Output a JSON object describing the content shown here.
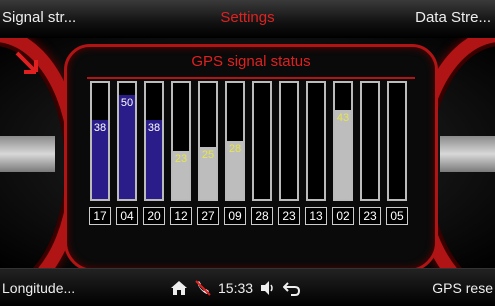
{
  "header": {
    "left_label": "Signal str...",
    "title": "Settings",
    "right_label": "Data Stre..."
  },
  "panel": {
    "title": "GPS signal status"
  },
  "chart_data": {
    "type": "bar",
    "categories": [
      "17",
      "04",
      "20",
      "12",
      "27",
      "09",
      "28",
      "23",
      "13",
      "02",
      "23",
      "05"
    ],
    "values": [
      38,
      50,
      38,
      23,
      25,
      28,
      0,
      0,
      0,
      43,
      0,
      0
    ],
    "value_labels": [
      "38",
      "50",
      "38",
      "23",
      "25",
      "28",
      "",
      "",
      "",
      "43",
      "",
      ""
    ],
    "bar_colors": [
      "#2a1d8a",
      "#2a1d8a",
      "#2a1d8a",
      "#bdbdbd",
      "#bdbdbd",
      "#bdbdbd",
      "#000000",
      "#000000",
      "#000000",
      "#bdbdbd",
      "#000000",
      "#000000"
    ],
    "label_colors": [
      "#ffffff",
      "#ffffff",
      "#ffffff",
      "#e6e64a",
      "#e6e64a",
      "#e6e64a",
      "#ffffff",
      "#ffffff",
      "#ffffff",
      "#e6e64a",
      "#ffffff",
      "#ffffff"
    ],
    "ylim": [
      0,
      56
    ]
  },
  "footer": {
    "left_label": "Longitude...",
    "time": "15:33",
    "right_label": "GPS rese",
    "icons": [
      "home-icon",
      "no-phone-icon",
      "volume-icon",
      "back-icon"
    ]
  },
  "colors": {
    "accent": "#b01414",
    "title_red": "#e02020"
  }
}
